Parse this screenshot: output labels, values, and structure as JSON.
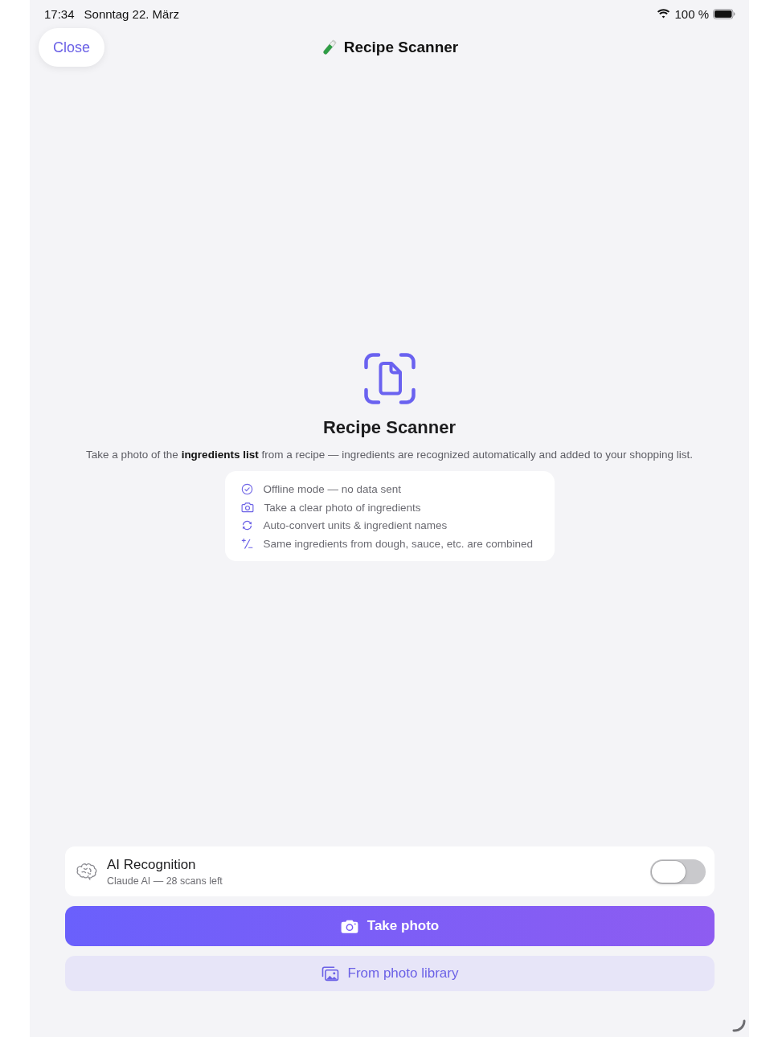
{
  "status_bar": {
    "time": "17:34",
    "date": "Sonntag 22. März",
    "battery": "100 %"
  },
  "nav": {
    "close": "Close",
    "title": "Recipe Scanner"
  },
  "hero": {
    "title": "Recipe Scanner",
    "description": "Take a photo of the **ingredients list** from a recipe — ingredients are recognized automatically and added to your shopping list."
  },
  "tips": [
    {
      "kind": "check",
      "text": "Offline mode — no data sent"
    },
    {
      "kind": "camera",
      "text": "Take a clear photo of ingredients"
    },
    {
      "kind": "convert",
      "text": "Auto-convert units & ingredient names"
    },
    {
      "kind": "combine",
      "text": "Same ingredients from dough, sauce, etc. are combined"
    }
  ],
  "ai_toggle": {
    "title": "AI Recognition",
    "subtitle": "Claude AI — 28 scans left",
    "on": false
  },
  "buttons": [
    {
      "kind": "primary",
      "label": "Take photo"
    },
    {
      "kind": "secondary",
      "label": "From photo library"
    }
  ]
}
